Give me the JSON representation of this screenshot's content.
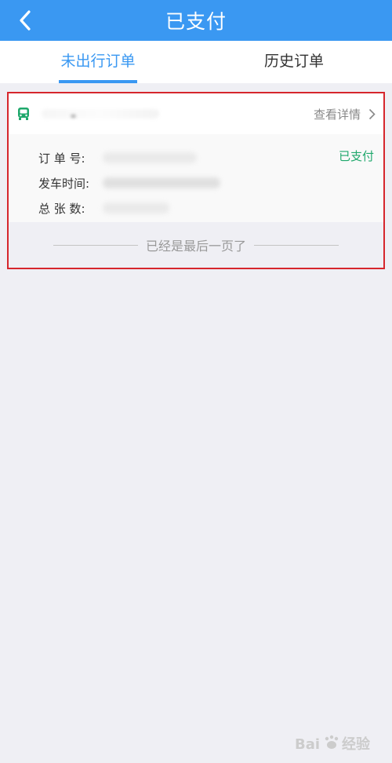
{
  "header": {
    "title": "已支付"
  },
  "tabs": [
    {
      "label": "未出行订单",
      "active": true
    },
    {
      "label": "历史订单",
      "active": false
    }
  ],
  "order": {
    "detail_link": "查看详情",
    "status": "已支付",
    "status_color": "#1fa86c",
    "fields": [
      {
        "label": "订 单 号:"
      },
      {
        "label": "发车时间:"
      },
      {
        "label": "总 张 数:"
      }
    ]
  },
  "list_end_text": "已经是最后一页了",
  "colors": {
    "primary": "#3a98f2",
    "highlight_border": "#d6262c"
  },
  "watermark": {
    "text": "Bai 经验"
  },
  "icons": {
    "back": "back-arrow-icon",
    "bus": "bus-icon",
    "chevron": "chevron-right-icon"
  }
}
